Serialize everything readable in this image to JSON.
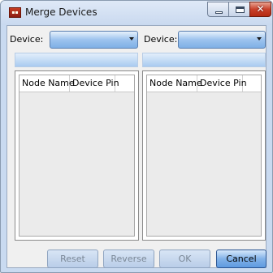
{
  "window": {
    "title": "Merge Devices",
    "icon": "app-device-icon"
  },
  "left": {
    "device_label": "Device:",
    "device_value": "",
    "columns": [
      "Node Name",
      "Device Pin"
    ]
  },
  "right": {
    "device_label": "Device:",
    "device_value": "",
    "columns": [
      "Node Name",
      "Device Pin"
    ]
  },
  "buttons": {
    "reset": "Reset",
    "reverse": "Reverse",
    "ok": "OK",
    "cancel": "Cancel"
  }
}
